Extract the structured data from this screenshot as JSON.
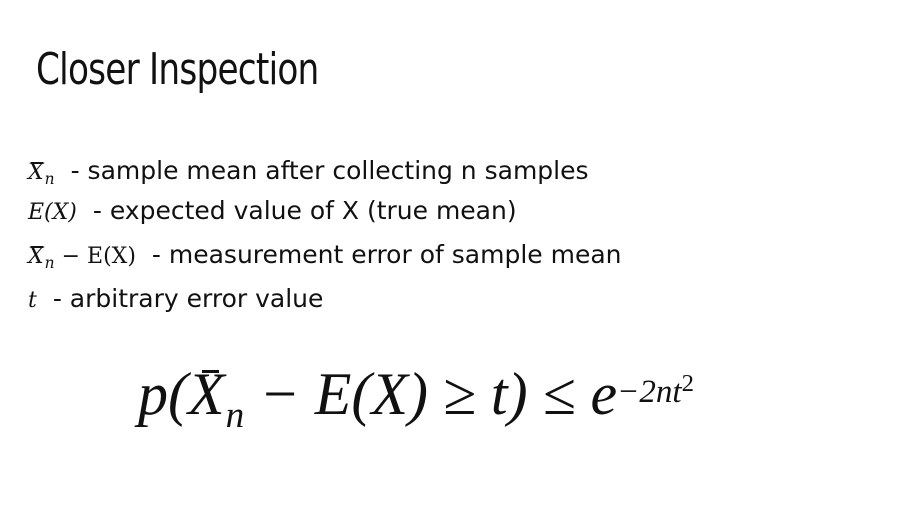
{
  "slide": {
    "title": "Closer Inspection",
    "definitions": [
      {
        "symbol": {
          "var": "X",
          "sub": "n"
        },
        "description": "- sample mean after collecting n samples"
      },
      {
        "symbol": {
          "text": "E(X)"
        },
        "description": "- expected value of X (true mean)"
      },
      {
        "symbol": {
          "var": "X",
          "sub": "n",
          "rest": " − E(X)"
        },
        "description": "- measurement error of sample mean"
      },
      {
        "symbol": {
          "text": "t"
        },
        "description": "- arbitrary error value"
      }
    ],
    "formula": {
      "p": "p(",
      "x": "X",
      "n": "n",
      "middle": " − E(X) ≥ t) ≤ e",
      "exp": "−2nt",
      "sq": "2"
    }
  }
}
